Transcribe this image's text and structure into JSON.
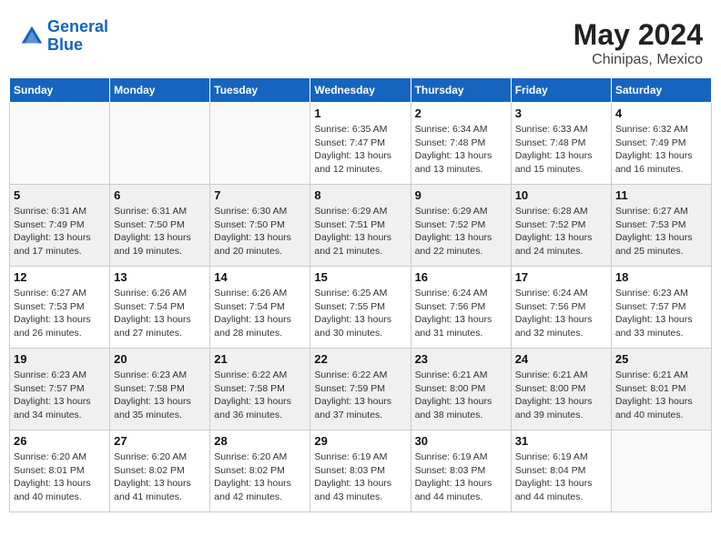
{
  "header": {
    "logo_line1": "General",
    "logo_line2": "Blue",
    "month": "May 2024",
    "location": "Chinipas, Mexico"
  },
  "weekdays": [
    "Sunday",
    "Monday",
    "Tuesday",
    "Wednesday",
    "Thursday",
    "Friday",
    "Saturday"
  ],
  "weeks": [
    [
      {
        "day": "",
        "info": ""
      },
      {
        "day": "",
        "info": ""
      },
      {
        "day": "",
        "info": ""
      },
      {
        "day": "1",
        "info": "Sunrise: 6:35 AM\nSunset: 7:47 PM\nDaylight: 13 hours\nand 12 minutes."
      },
      {
        "day": "2",
        "info": "Sunrise: 6:34 AM\nSunset: 7:48 PM\nDaylight: 13 hours\nand 13 minutes."
      },
      {
        "day": "3",
        "info": "Sunrise: 6:33 AM\nSunset: 7:48 PM\nDaylight: 13 hours\nand 15 minutes."
      },
      {
        "day": "4",
        "info": "Sunrise: 6:32 AM\nSunset: 7:49 PM\nDaylight: 13 hours\nand 16 minutes."
      }
    ],
    [
      {
        "day": "5",
        "info": "Sunrise: 6:31 AM\nSunset: 7:49 PM\nDaylight: 13 hours\nand 17 minutes."
      },
      {
        "day": "6",
        "info": "Sunrise: 6:31 AM\nSunset: 7:50 PM\nDaylight: 13 hours\nand 19 minutes."
      },
      {
        "day": "7",
        "info": "Sunrise: 6:30 AM\nSunset: 7:50 PM\nDaylight: 13 hours\nand 20 minutes."
      },
      {
        "day": "8",
        "info": "Sunrise: 6:29 AM\nSunset: 7:51 PM\nDaylight: 13 hours\nand 21 minutes."
      },
      {
        "day": "9",
        "info": "Sunrise: 6:29 AM\nSunset: 7:52 PM\nDaylight: 13 hours\nand 22 minutes."
      },
      {
        "day": "10",
        "info": "Sunrise: 6:28 AM\nSunset: 7:52 PM\nDaylight: 13 hours\nand 24 minutes."
      },
      {
        "day": "11",
        "info": "Sunrise: 6:27 AM\nSunset: 7:53 PM\nDaylight: 13 hours\nand 25 minutes."
      }
    ],
    [
      {
        "day": "12",
        "info": "Sunrise: 6:27 AM\nSunset: 7:53 PM\nDaylight: 13 hours\nand 26 minutes."
      },
      {
        "day": "13",
        "info": "Sunrise: 6:26 AM\nSunset: 7:54 PM\nDaylight: 13 hours\nand 27 minutes."
      },
      {
        "day": "14",
        "info": "Sunrise: 6:26 AM\nSunset: 7:54 PM\nDaylight: 13 hours\nand 28 minutes."
      },
      {
        "day": "15",
        "info": "Sunrise: 6:25 AM\nSunset: 7:55 PM\nDaylight: 13 hours\nand 30 minutes."
      },
      {
        "day": "16",
        "info": "Sunrise: 6:24 AM\nSunset: 7:56 PM\nDaylight: 13 hours\nand 31 minutes."
      },
      {
        "day": "17",
        "info": "Sunrise: 6:24 AM\nSunset: 7:56 PM\nDaylight: 13 hours\nand 32 minutes."
      },
      {
        "day": "18",
        "info": "Sunrise: 6:23 AM\nSunset: 7:57 PM\nDaylight: 13 hours\nand 33 minutes."
      }
    ],
    [
      {
        "day": "19",
        "info": "Sunrise: 6:23 AM\nSunset: 7:57 PM\nDaylight: 13 hours\nand 34 minutes."
      },
      {
        "day": "20",
        "info": "Sunrise: 6:23 AM\nSunset: 7:58 PM\nDaylight: 13 hours\nand 35 minutes."
      },
      {
        "day": "21",
        "info": "Sunrise: 6:22 AM\nSunset: 7:58 PM\nDaylight: 13 hours\nand 36 minutes."
      },
      {
        "day": "22",
        "info": "Sunrise: 6:22 AM\nSunset: 7:59 PM\nDaylight: 13 hours\nand 37 minutes."
      },
      {
        "day": "23",
        "info": "Sunrise: 6:21 AM\nSunset: 8:00 PM\nDaylight: 13 hours\nand 38 minutes."
      },
      {
        "day": "24",
        "info": "Sunrise: 6:21 AM\nSunset: 8:00 PM\nDaylight: 13 hours\nand 39 minutes."
      },
      {
        "day": "25",
        "info": "Sunrise: 6:21 AM\nSunset: 8:01 PM\nDaylight: 13 hours\nand 40 minutes."
      }
    ],
    [
      {
        "day": "26",
        "info": "Sunrise: 6:20 AM\nSunset: 8:01 PM\nDaylight: 13 hours\nand 40 minutes."
      },
      {
        "day": "27",
        "info": "Sunrise: 6:20 AM\nSunset: 8:02 PM\nDaylight: 13 hours\nand 41 minutes."
      },
      {
        "day": "28",
        "info": "Sunrise: 6:20 AM\nSunset: 8:02 PM\nDaylight: 13 hours\nand 42 minutes."
      },
      {
        "day": "29",
        "info": "Sunrise: 6:19 AM\nSunset: 8:03 PM\nDaylight: 13 hours\nand 43 minutes."
      },
      {
        "day": "30",
        "info": "Sunrise: 6:19 AM\nSunset: 8:03 PM\nDaylight: 13 hours\nand 44 minutes."
      },
      {
        "day": "31",
        "info": "Sunrise: 6:19 AM\nSunset: 8:04 PM\nDaylight: 13 hours\nand 44 minutes."
      },
      {
        "day": "",
        "info": ""
      }
    ]
  ]
}
